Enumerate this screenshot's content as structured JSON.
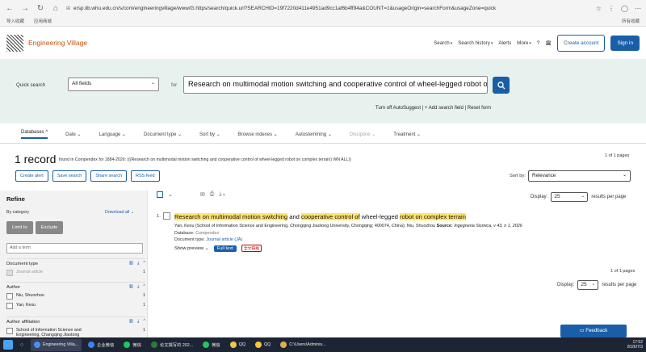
{
  "browser": {
    "url": "ersp.lib.whu.edu.cn/s/com/engineeringvillage/www/G.https/search/quick.url?SEARCHID=19f7220d411e4951ad9cc1af6b4ff94a&COUNT=1&usageOrigin=searchForm&usageZone=quick",
    "bookmarks": [
      "导入收藏",
      "应用商城"
    ],
    "bookmark_right": "所有收藏"
  },
  "header": {
    "brand": "Engineering Village",
    "nav": [
      "Search",
      "Search history",
      "Alerts",
      "More"
    ],
    "create_account": "Create account",
    "sign_in": "Sign in"
  },
  "search": {
    "quick_label": "Quick search",
    "field": "All fields",
    "for_label": "for",
    "term": "Research on multimodal motion switching and cooperative control of wheel-legged robot on complex terrain",
    "turn_off": "Turn off AutoSuggest",
    "add_field": "+ Add search field",
    "reset": "Reset form"
  },
  "facets": [
    "Databases",
    "Date",
    "Language",
    "Document type",
    "Sort by",
    "Browse indexes",
    "Autostemming",
    "Discipline",
    "Treatment"
  ],
  "summary": {
    "count": "1 record",
    "found": "found in Compendex for 1884-2026: (((Research on multimodal motion switching and cooperative control of wheel-legged robot on complex terrain) WN ALL))",
    "page_of": "1 of 1 pages",
    "buttons": [
      "Create alert",
      "Save search",
      "Share search",
      "RSS feed"
    ],
    "sort_label": "Sort by:",
    "sort_value": "Relevance"
  },
  "refine": {
    "title": "Refine",
    "by_category": "By category",
    "download_all": "Download all",
    "limit_to": "Limit to",
    "exclude": "Exclude",
    "add_term": "Add a term",
    "sections": [
      {
        "title": "Document type",
        "items": [
          {
            "label": "Journal article",
            "count": "1"
          }
        ]
      },
      {
        "title": "Author",
        "items": [
          {
            "label": "Niu, Shuozhou",
            "count": "1"
          },
          {
            "label": "Yan, Kexu",
            "count": "1"
          }
        ]
      },
      {
        "title": "Author affiliation",
        "items": [
          {
            "label": "School of Information Science and Engineering, Changqing Jiaotong",
            "count": "1"
          }
        ]
      }
    ]
  },
  "results": {
    "display_label": "Display:",
    "per_page": "25",
    "per_page_suffix": "results per page",
    "item": {
      "num": "1.",
      "title_parts": [
        {
          "t": "Research on multimodal motion switching",
          "h": true
        },
        {
          "t": " and ",
          "h": false
        },
        {
          "t": "cooperative control of",
          "h": true
        },
        {
          "t": " wheel-legged ",
          "h": false
        },
        {
          "t": "robot on complex terrain",
          "h": true
        }
      ],
      "authors": "Yan, Kexu (School of Information Science and Engineering, Chongqing Jiaotong University, Chongqing; 400074, China); Niu, Shuozhou",
      "source_label": "Source:",
      "source": "Ingegneria Sismica, v 43, n 1, 2026",
      "database_label": "Database:",
      "database": "Compendex",
      "doctype_label": "Document type:",
      "doctype": "Journal article (JA)",
      "show_preview": "Show preview",
      "full_text": "Full text",
      "badge": "全文链接"
    },
    "page_of": "1 of 1 pages",
    "feedback": "Feedback"
  },
  "taskbar": {
    "apps": [
      "Engineering Villa...",
      "企业微信",
      "微信",
      "论文撰写的 202...",
      "微信",
      "QQ",
      "QQ",
      "C:\\Users\\Adminis..."
    ],
    "time": "17:52",
    "date": "2026/7/3"
  }
}
